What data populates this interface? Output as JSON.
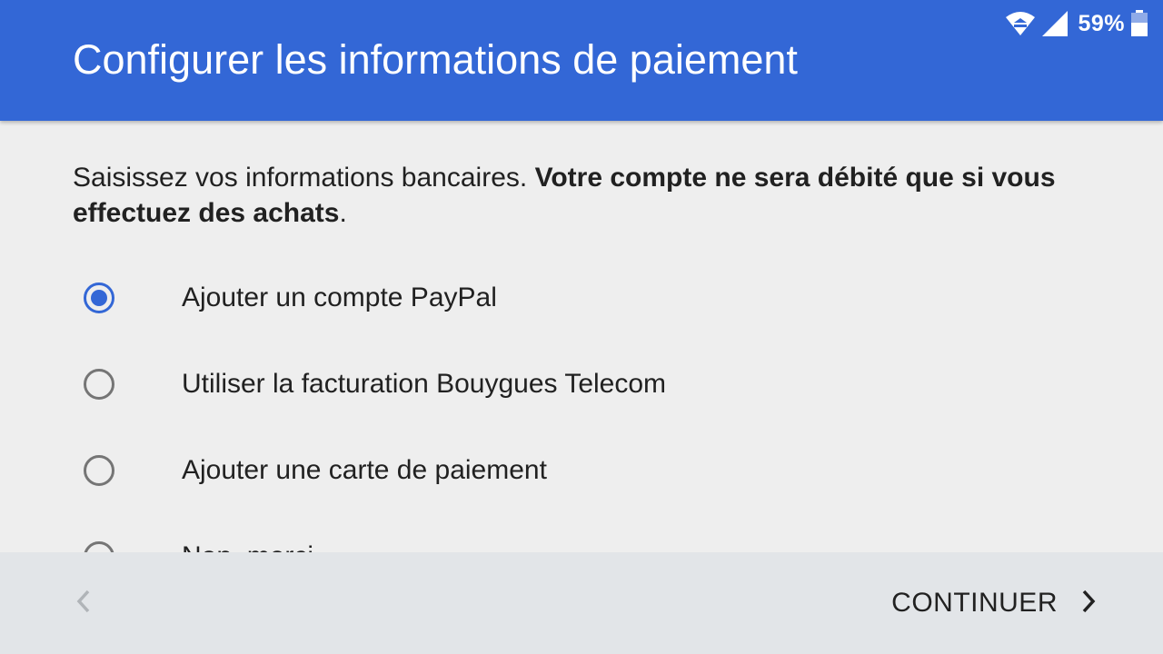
{
  "status_bar": {
    "battery_percent": "59%",
    "icons": [
      "wifi-icon",
      "cell-signal-icon",
      "battery-icon"
    ]
  },
  "header": {
    "title": "Configurer les informations de paiement"
  },
  "intro": {
    "text_regular": "Saisissez vos informations bancaires. ",
    "text_bold": "Votre compte ne sera débité que si vous effectuez des achats",
    "text_end": "."
  },
  "options": [
    {
      "label": "Ajouter un compte PayPal",
      "selected": true
    },
    {
      "label": "Utiliser la facturation Bouygues Telecom",
      "selected": false
    },
    {
      "label": "Ajouter une carte de paiement",
      "selected": false
    },
    {
      "label": "Non, merci",
      "selected": false
    }
  ],
  "footer": {
    "continue_label": "CONTINUER",
    "back_icon": "chevron-left-icon",
    "continue_icon": "chevron-right-icon"
  },
  "colors": {
    "header_bg": "#3367d6",
    "accent": "#3367d6",
    "content_bg": "#eeeeee",
    "footer_bg": "#e2e5e8"
  }
}
